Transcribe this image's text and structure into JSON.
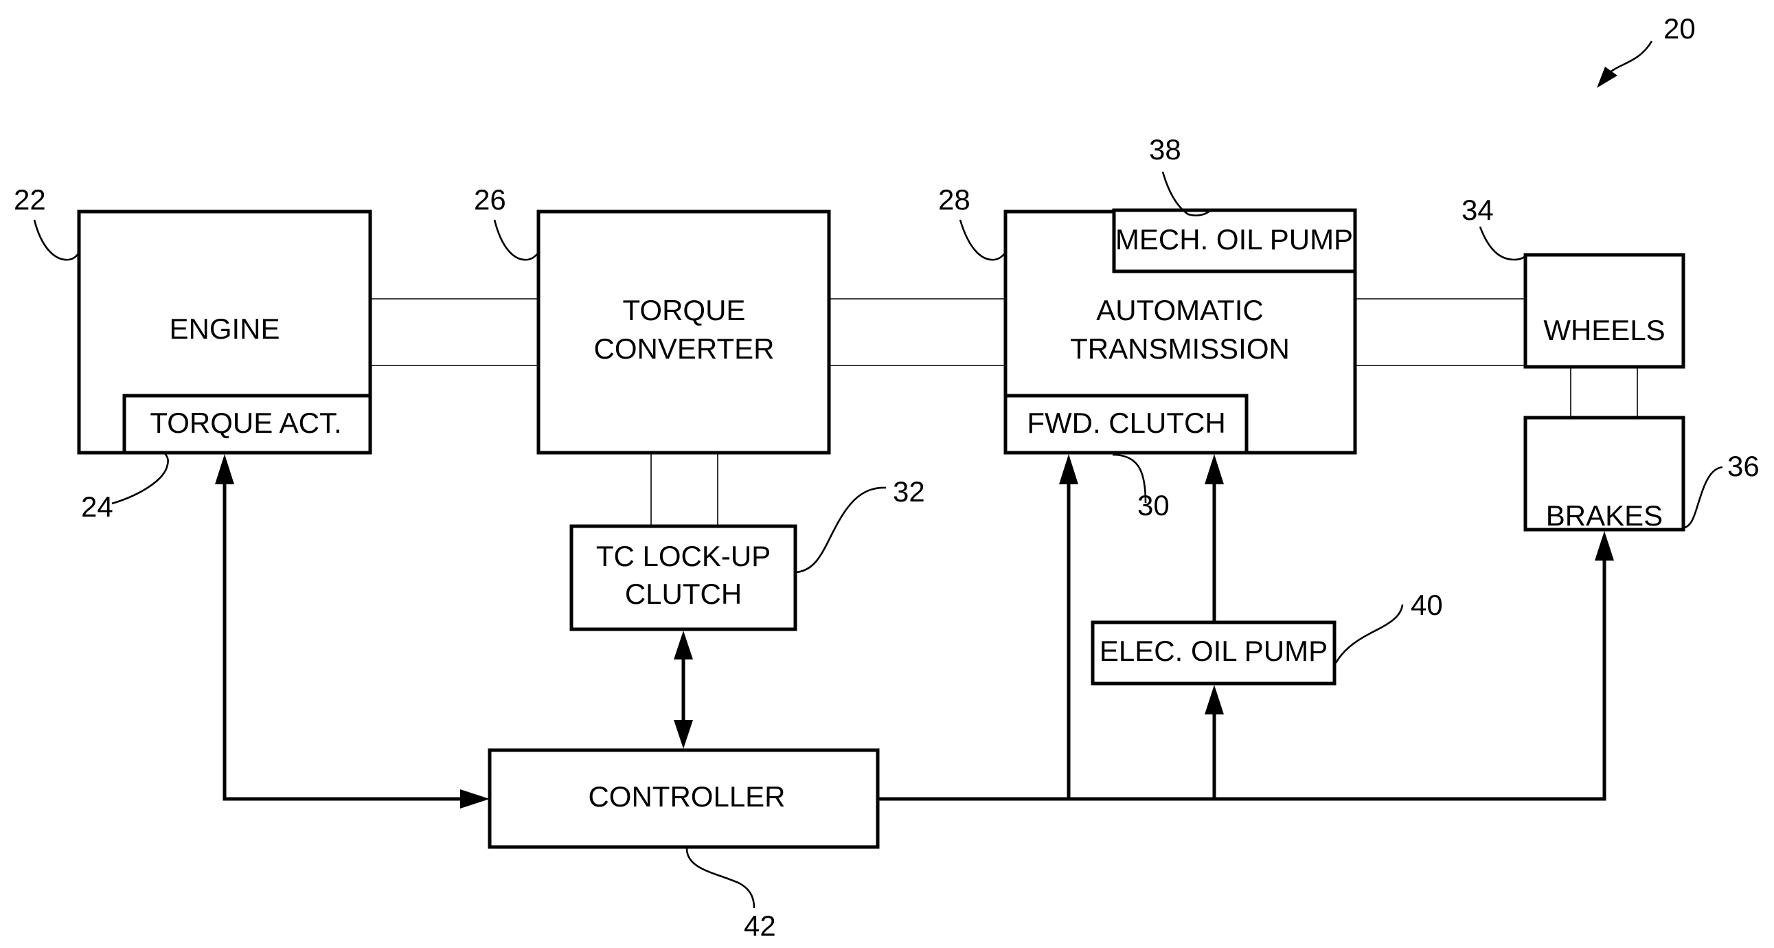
{
  "figure": {
    "reference": "20",
    "components": {
      "engine": {
        "label": "ENGINE",
        "ref": "22"
      },
      "torque_actuator": {
        "label": "TORQUE ACT.",
        "ref": "24"
      },
      "torque_converter": {
        "label_lines": [
          "TORQUE",
          "CONVERTER"
        ],
        "ref": "26"
      },
      "transmission": {
        "label_lines": [
          "AUTOMATIC",
          "TRANSMISSION"
        ],
        "ref": "28"
      },
      "forward_clutch": {
        "label": "FWD. CLUTCH",
        "ref": "30"
      },
      "tc_lockup_clutch": {
        "label_lines": [
          "TC LOCK-UP",
          "CLUTCH"
        ],
        "ref": "32"
      },
      "wheels": {
        "label": "WHEELS",
        "ref": "34"
      },
      "brakes": {
        "label": "BRAKES",
        "ref": "36"
      },
      "mech_oil_pump": {
        "label": "MECH. OIL PUMP",
        "ref": "38"
      },
      "elec_oil_pump": {
        "label": "ELEC. OIL PUMP",
        "ref": "40"
      },
      "controller": {
        "label": "CONTROLLER",
        "ref": "42"
      }
    },
    "connections": [
      {
        "from": "engine",
        "to": "torque_converter",
        "type": "mechanical"
      },
      {
        "from": "torque_converter",
        "to": "transmission",
        "type": "mechanical"
      },
      {
        "from": "transmission",
        "to": "wheels",
        "type": "mechanical"
      },
      {
        "from": "wheels",
        "to": "brakes",
        "type": "mechanical"
      },
      {
        "from": "torque_converter",
        "to": "tc_lockup_clutch",
        "type": "mechanical"
      },
      {
        "from": "controller",
        "to": "torque_actuator",
        "type": "signal",
        "direction": "bidirectional"
      },
      {
        "from": "controller",
        "to": "tc_lockup_clutch",
        "type": "signal",
        "direction": "bidirectional"
      },
      {
        "from": "controller",
        "to": "forward_clutch",
        "type": "signal",
        "direction": "one-way"
      },
      {
        "from": "controller",
        "to": "elec_oil_pump",
        "type": "signal",
        "direction": "one-way"
      },
      {
        "from": "elec_oil_pump",
        "to": "forward_clutch",
        "type": "hydraulic",
        "direction": "one-way"
      },
      {
        "from": "controller",
        "to": "brakes",
        "type": "signal",
        "direction": "one-way"
      }
    ]
  }
}
